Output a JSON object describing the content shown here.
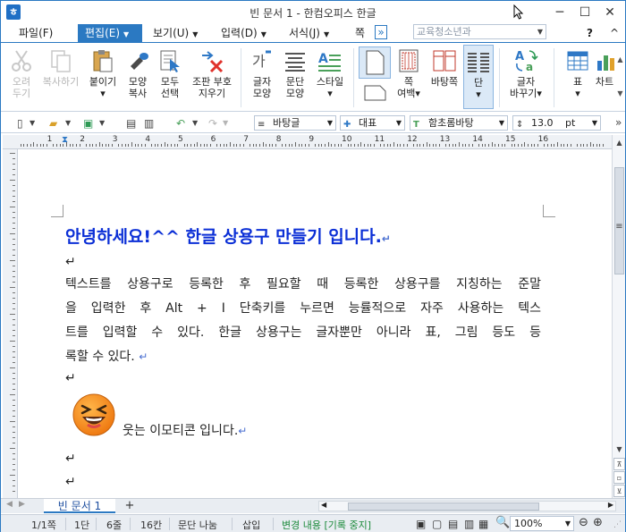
{
  "window": {
    "title": "빈 문서 1 - 한컴오피스 한글",
    "app_icon_letter": "ㅎ",
    "minimize": "─",
    "maximize": "☐",
    "close": "✕"
  },
  "menubar": {
    "items": [
      "파일(F)",
      "편집(E)",
      "보기(U)",
      "입력(D)",
      "서식(J)",
      "쪽(W)"
    ],
    "active": "편집(E)",
    "more": "»",
    "search_placeholder": "교육청소년과",
    "help": "?",
    "ribbon_min": "^"
  },
  "ribbon": {
    "buttons": [
      {
        "label1": "오려",
        "label2": "두기",
        "icon": "scissors-icon"
      },
      {
        "label1": "복사하기",
        "label2": "",
        "icon": "copy-icon"
      },
      {
        "label1": "붙이기",
        "label2": "▾",
        "icon": "paste-icon"
      },
      {
        "label1": "모양",
        "label2": "복사",
        "icon": "format-painter-icon"
      },
      {
        "label1": "모두",
        "label2": "선택",
        "icon": "select-all-icon"
      },
      {
        "label1": "조판 부호",
        "label2": "지우기",
        "icon": "clear-codes-icon"
      },
      {
        "label1": "글자",
        "label2": "모양",
        "icon": "char-shape-icon"
      },
      {
        "label1": "문단",
        "label2": "모양",
        "icon": "para-shape-icon"
      },
      {
        "label1": "스타일",
        "label2": "▾",
        "icon": "style-icon"
      },
      {
        "label1": "쪽",
        "label2": "여백▾",
        "icon": "margin-icon"
      },
      {
        "label1": "바탕쪽",
        "label2": "",
        "icon": "master-page-icon"
      },
      {
        "label1": "단",
        "label2": "▾",
        "icon": "columns-icon"
      },
      {
        "label1": "글자",
        "label2": "바꾸기▾",
        "icon": "replace-icon"
      },
      {
        "label1": "표",
        "label2": "▾",
        "icon": "table-icon"
      },
      {
        "label1": "차트",
        "label2": "",
        "icon": "chart-icon"
      }
    ]
  },
  "toolbar": {
    "style_value": "바탕글",
    "font_lang_value": "대표",
    "font_value": "함초롬바탕",
    "size_value": "13.0",
    "size_unit": "pt"
  },
  "ruler": {
    "numbers": [
      "1",
      "2",
      "3",
      "4",
      "5",
      "6",
      "7",
      "8",
      "9",
      "10",
      "11",
      "12",
      "13",
      "14",
      "15",
      "16"
    ]
  },
  "document": {
    "heading": "안녕하세요!^^ 한글 상용구 만들기 입니다.",
    "body_lines": [
      "텍스트를 상용구로 등록한 후 필요할 때 등록한 상용구를 지칭하는 준말",
      "을 입력한 후 Alt + I 단축키를 누르면 능률적으로 자주 사용하는 텍스",
      "트를 입력할 수 있다. 한글 상용구는 글자뿐만 아니라 표, 그림 등도 등",
      "록할 수 있다."
    ],
    "emoticon_caption": "웃는 이모티콘 입니다.",
    "para_mark": "↵"
  },
  "tabs": {
    "active_tab": "빈 문서 1",
    "add": "+"
  },
  "status": {
    "page": "1/1쪽",
    "column": "1단",
    "line": "6줄",
    "col_pos": "16칸",
    "section": "문단 나눔",
    "insert_mode": "삽입",
    "track_changes": "변경 내용 [기록 중지]",
    "zoom": "100%"
  }
}
